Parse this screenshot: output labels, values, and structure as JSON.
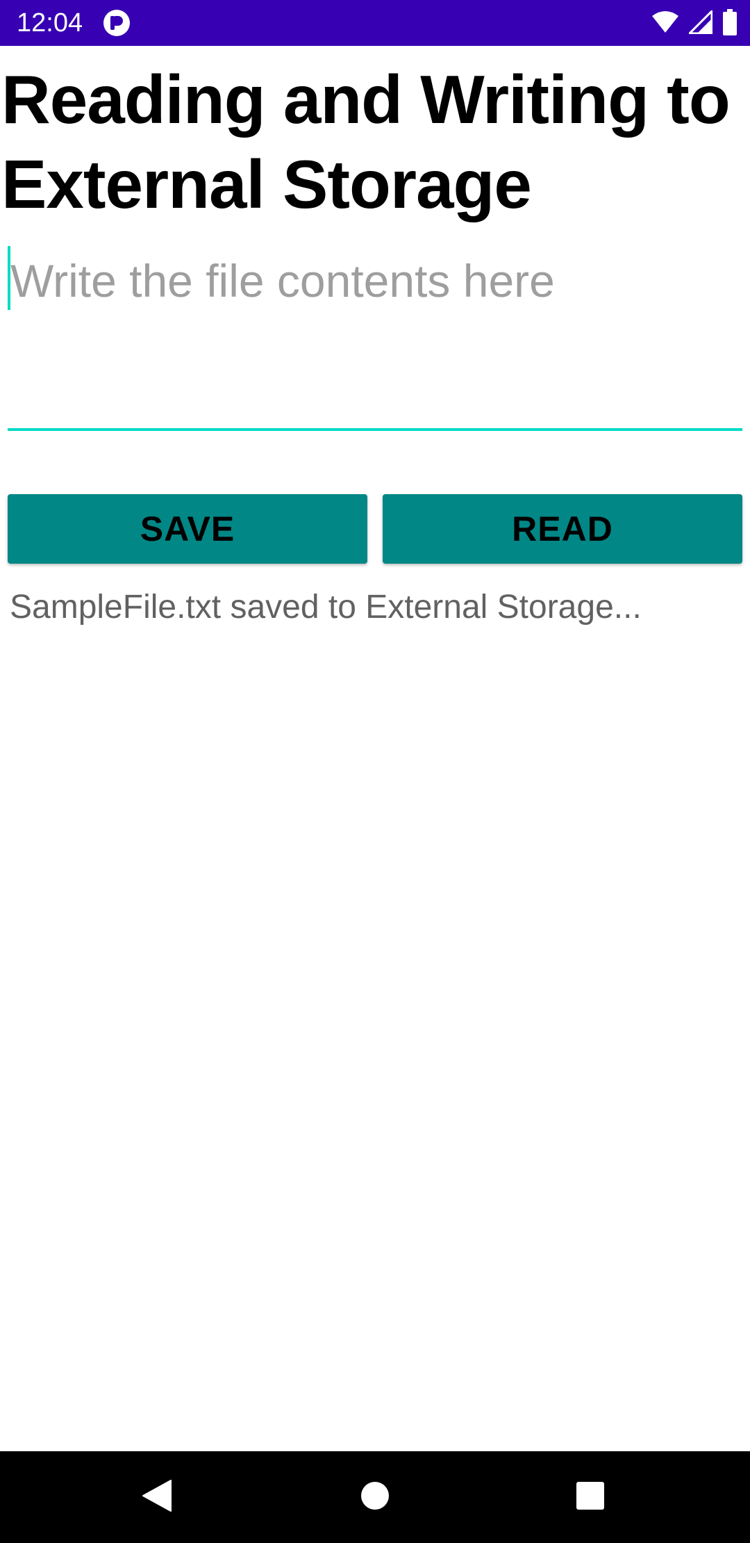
{
  "status_bar": {
    "time": "12:04",
    "background_color": "#3700b3",
    "icons": [
      "app-notification-icon",
      "wifi-icon",
      "signal-icon",
      "battery-icon"
    ]
  },
  "page": {
    "title": "Reading and Writing to External Storage"
  },
  "file_input": {
    "value": "",
    "placeholder": "Write the file contents here",
    "accent_color": "#03dac5"
  },
  "buttons": {
    "save_label": "SAVE",
    "read_label": "READ",
    "color": "#018786"
  },
  "status_message": "SampleFile.txt saved to External Storage...",
  "nav_bar": {
    "icons": [
      "back-icon",
      "home-icon",
      "recents-icon"
    ]
  }
}
